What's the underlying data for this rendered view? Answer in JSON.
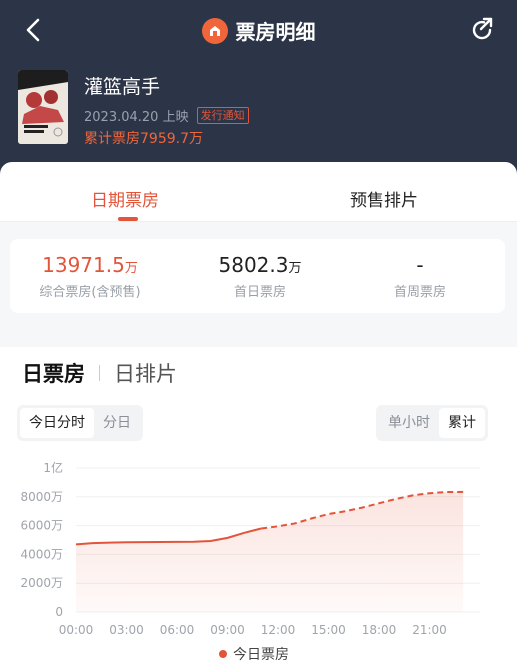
{
  "header": {
    "title": "票房明细",
    "movie_name": "灌篮高手",
    "release": "2023.04.20 上映",
    "tag": "发行通知",
    "cumulative": "累计票房7959.7万"
  },
  "tabs": {
    "active": "日期票房",
    "other": "预售排片"
  },
  "stats": [
    {
      "value": "13971.5",
      "unit": "万",
      "label": "综合票房(含预售)"
    },
    {
      "value": "5802.3",
      "unit": "万",
      "label": "首日票房"
    },
    {
      "value": "-",
      "unit": "",
      "label": "首周票房"
    }
  ],
  "section": {
    "active": "日票房",
    "other": "日排片"
  },
  "segment_left": [
    "今日分时",
    "分日"
  ],
  "segment_right": [
    "单小时",
    "累计"
  ],
  "colors": {
    "accent": "#e2553a",
    "header_bg": "#2c3447"
  },
  "chart_data": {
    "type": "line",
    "y_ticks": [
      "0",
      "2000万",
      "4000万",
      "6000万",
      "8000万",
      "1亿"
    ],
    "x_ticks": [
      "00:00",
      "03:00",
      "06:00",
      "09:00",
      "12:00",
      "15:00",
      "18:00",
      "21:00"
    ],
    "ylim": [
      0,
      10000
    ],
    "y_unit": "万",
    "series": [
      {
        "name": "今日票房",
        "actual_x": [
          0,
          1,
          2,
          3,
          4,
          5,
          6,
          7,
          8,
          9,
          10,
          11
        ],
        "actual_y": [
          4700,
          4780,
          4820,
          4840,
          4850,
          4860,
          4870,
          4880,
          4930,
          5150,
          5500,
          5800
        ],
        "forecast_x": [
          11,
          12,
          13,
          14,
          15,
          16,
          17,
          18,
          19,
          20,
          21,
          22,
          23
        ],
        "forecast_y": [
          5800,
          5950,
          6150,
          6500,
          6800,
          7000,
          7250,
          7550,
          7850,
          8100,
          8250,
          8330,
          8340
        ]
      }
    ]
  }
}
